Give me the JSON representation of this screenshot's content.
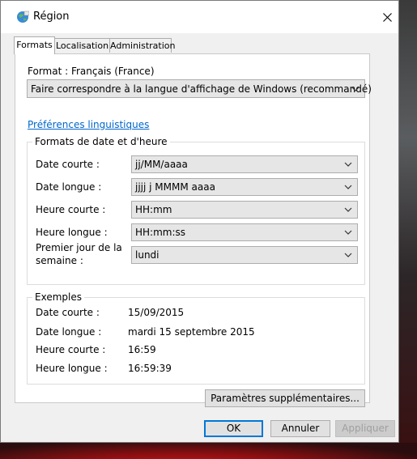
{
  "window": {
    "title": "Région",
    "icon": "globe-region-icon",
    "close_icon": "close-icon"
  },
  "tabs": [
    {
      "label": "Formats",
      "active": true
    },
    {
      "label": "Localisation",
      "active": false
    },
    {
      "label": "Administration",
      "active": false
    }
  ],
  "format": {
    "label": "Format : Français (France)",
    "selected": "Faire correspondre à la langue d'affichage de Windows (recommandé)"
  },
  "language_link": "Préférences linguistiques",
  "date_time_formats": {
    "title": "Formats de date et d'heure",
    "rows": [
      {
        "label": "Date courte :",
        "value": "jj/MM/aaaa"
      },
      {
        "label": "Date longue :",
        "value": "jjjj j MMMM aaaa"
      },
      {
        "label": "Heure courte :",
        "value": "HH:mm"
      },
      {
        "label": "Heure longue :",
        "value": "HH:mm:ss"
      }
    ],
    "first_day": {
      "label_line1": "Premier jour de la",
      "label_line2": "semaine :",
      "value": "lundi"
    }
  },
  "examples": {
    "title": "Exemples",
    "rows": [
      {
        "label": "Date courte :",
        "value": "15/09/2015"
      },
      {
        "label": "Date longue :",
        "value": "mardi 15 septembre 2015"
      },
      {
        "label": "Heure courte :",
        "value": "16:59"
      },
      {
        "label": "Heure longue :",
        "value": "16:59:39"
      }
    ]
  },
  "buttons": {
    "additional": "Paramètres supplémentaires...",
    "ok": "OK",
    "cancel": "Annuler",
    "apply": "Appliquer"
  }
}
